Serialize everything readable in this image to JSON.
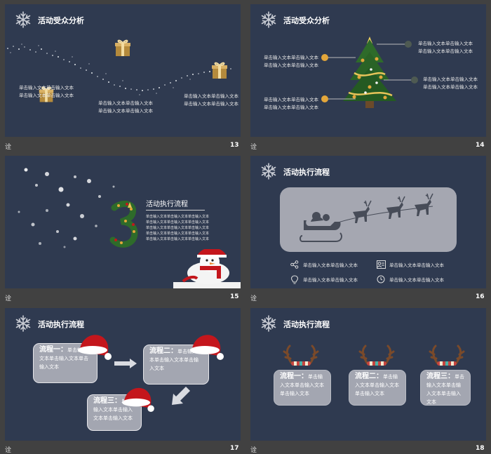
{
  "slides": [
    {
      "number": "13",
      "title": "活动受众分析",
      "texts": [
        "单击输入文本单击输入文本",
        "单击输入文本单击输入文本",
        "单击输入文本单击输入文本",
        "单击输入文本单击输入文本",
        "单击输入文本单击输入文本",
        "单击输入文本单击输入文本"
      ]
    },
    {
      "number": "14",
      "title": "活动受众分析",
      "texts": [
        "单击输入文本单击输入文本",
        "单击输入文本单击输入文本",
        "单击输入文本单击输入文本",
        "单击输入文本单击输入文本",
        "单击输入文本单击输入文本",
        "单击输入文本单击输入文本",
        "单击输入文本单击输入文本",
        "单击输入文本单击输入文本"
      ]
    },
    {
      "number": "15",
      "title": "活动执行流程",
      "texts": [
        "单击输入文本单击输入文本单击输入文本",
        "单击输入文本单击输入文本单击输入文本",
        "单击输入文本单击输入文本单击输入文本",
        "单击输入文本单击输入文本单击输入文本",
        "单击输入文本单击输入文本单击输入文本"
      ]
    },
    {
      "number": "16",
      "title": "活动执行流程",
      "items": [
        "单击输入文本单击输入文本",
        "单击输入文本单击输入文本",
        "单击输入文本单击输入文本",
        "单击输入文本单击输入文本"
      ]
    },
    {
      "number": "17",
      "title": "活动执行流程",
      "steps": [
        {
          "label": "流程一：",
          "text": "单击输入文本单击输入文本单击输入文本"
        },
        {
          "label": "流程二：",
          "text": "单击输入文本单击输入文本单击输入文本"
        },
        {
          "label": "流程三：",
          "text": "单击输入文本单击输入文本单击输入文本"
        }
      ]
    },
    {
      "number": "18",
      "title": "活动执行流程",
      "steps": [
        {
          "label": "流程一：",
          "text": "单击输入文本单击输入文本单击输入文本"
        },
        {
          "label": "流程二：",
          "text": "单击输入文本单击输入文本单击输入文本"
        },
        {
          "label": "流程三：",
          "text": "单击输入文本单击输入文本单击输入文本"
        }
      ]
    }
  ],
  "footer_mark": "诠",
  "colors": {
    "slide_bg": "#2f3a50",
    "page_bg": "#414141",
    "panel": "#a5a7b1",
    "gold": "#e3a63a"
  }
}
